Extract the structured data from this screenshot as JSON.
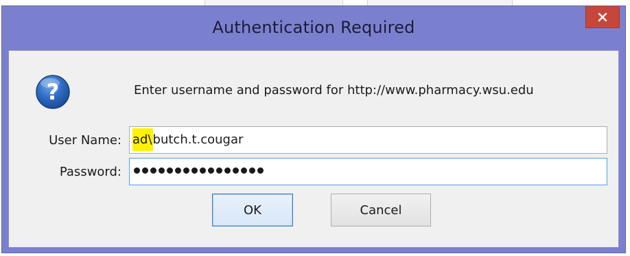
{
  "dialog": {
    "title": "Authentication Required",
    "message": "Enter username and password for http://www.pharmacy.wsu.edu",
    "icon": "question-icon",
    "username_label": "User Name:",
    "username_highlight": "ad\\",
    "username_rest": "butch.t.cougar",
    "password_label": "Password:",
    "password_length": 16,
    "ok_label": "OK",
    "cancel_label": "Cancel"
  },
  "colors": {
    "titlebar": "#7b80ce",
    "close_button": "#c7463a",
    "client_background": "#f0f0f0",
    "highlight": "#fff200",
    "focus_border": "#5c9be3"
  }
}
